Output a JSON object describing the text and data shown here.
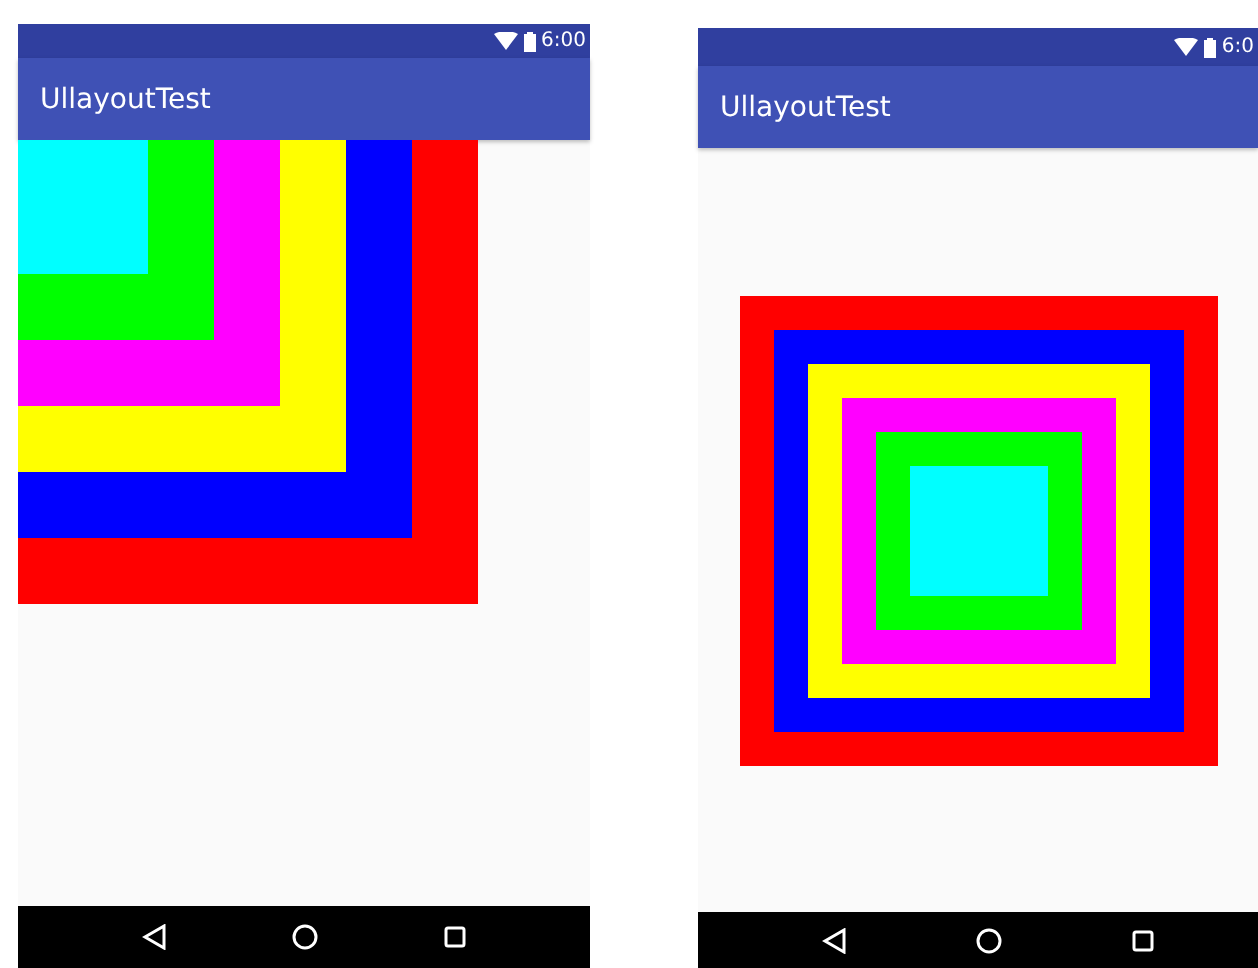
{
  "phones": [
    {
      "status_time": "6:00",
      "title": "UllayoutTest",
      "centered": false
    },
    {
      "status_time": "6:0",
      "title": "UllayoutTest",
      "centered": true
    }
  ]
}
